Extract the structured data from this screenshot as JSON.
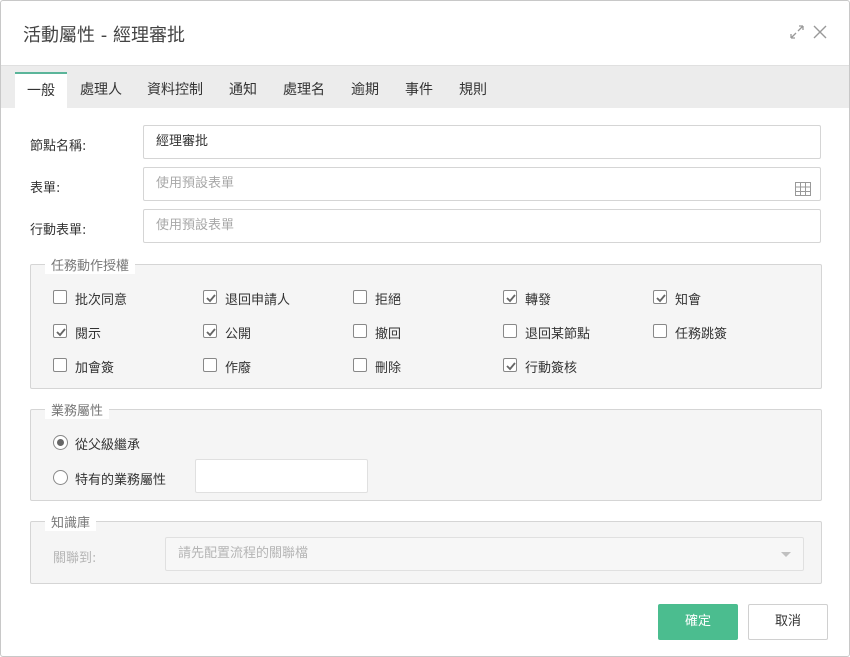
{
  "dialog": {
    "title": "活動屬性 - 經理審批"
  },
  "tabs": [
    {
      "label": "一般",
      "active": true
    },
    {
      "label": "處理人"
    },
    {
      "label": "資料控制"
    },
    {
      "label": "通知"
    },
    {
      "label": "處理名"
    },
    {
      "label": "逾期"
    },
    {
      "label": "事件"
    },
    {
      "label": "規則"
    }
  ],
  "form": {
    "node_name_label": "節點名稱:",
    "node_name_value": "經理審批",
    "form_label": "表單:",
    "form_placeholder": "使用預設表單",
    "mobile_form_label": "行動表單:",
    "mobile_form_placeholder": "使用預設表單"
  },
  "permissions": {
    "legend": "任務動作授權",
    "items": [
      {
        "label": "批次同意",
        "checked": false
      },
      {
        "label": "退回申請人",
        "checked": true
      },
      {
        "label": "拒絕",
        "checked": false
      },
      {
        "label": "轉發",
        "checked": true
      },
      {
        "label": "知會",
        "checked": true
      },
      {
        "label": "閱示",
        "checked": true
      },
      {
        "label": "公開",
        "checked": true
      },
      {
        "label": "撤回",
        "checked": false
      },
      {
        "label": "退回某節點",
        "checked": false
      },
      {
        "label": "任務跳簽",
        "checked": false
      },
      {
        "label": "加會簽",
        "checked": false
      },
      {
        "label": "作廢",
        "checked": false
      },
      {
        "label": "刪除",
        "checked": false
      },
      {
        "label": "行動簽核",
        "checked": true
      }
    ]
  },
  "business": {
    "legend": "業務屬性",
    "inherit_label": "從父級繼承",
    "specific_label": "特有的業務屬性",
    "selected": "inherit"
  },
  "knowledge": {
    "legend": "知識庫",
    "link_label": "關聯到:",
    "link_placeholder": "請先配置流程的關聯檔"
  },
  "buttons": {
    "confirm": "確定",
    "cancel": "取消"
  },
  "colors": {
    "accent": "#4bbd8f",
    "tab_indicator": "#5bb59a"
  },
  "icons": {
    "expand": "expand-icon",
    "close": "close-icon",
    "table": "table-icon"
  }
}
